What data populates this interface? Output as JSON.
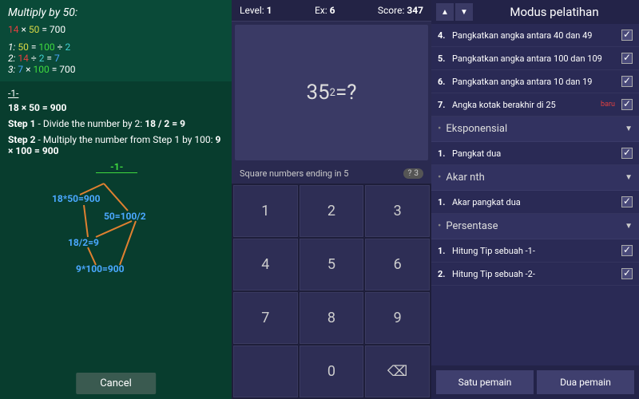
{
  "panel1": {
    "title": "Multiply by 50:",
    "topEq": {
      "a": "14",
      "b": "50",
      "res": "700"
    },
    "hints": [
      {
        "n": "1:",
        "parts": [
          {
            "t": "50",
            "c": "yel"
          },
          {
            "t": " = ",
            "c": "wht"
          },
          {
            "t": "100",
            "c": "grn"
          },
          {
            "t": " ÷ ",
            "c": "wht"
          },
          {
            "t": "2",
            "c": "cyan"
          }
        ]
      },
      {
        "n": "2:",
        "parts": [
          {
            "t": "14",
            "c": "red"
          },
          {
            "t": " ÷ ",
            "c": "wht"
          },
          {
            "t": "2",
            "c": "cyan"
          },
          {
            "t": " = ",
            "c": "wht"
          },
          {
            "t": "7",
            "c": "blu"
          }
        ]
      },
      {
        "n": "3:",
        "parts": [
          {
            "t": "7",
            "c": "blu"
          },
          {
            "t": " × ",
            "c": "wht"
          },
          {
            "t": "100",
            "c": "grn"
          },
          {
            "t": " = 700",
            "c": "wht"
          }
        ]
      }
    ],
    "section": "-1-",
    "eq2": "18 × 50 = 900",
    "step1lbl": "Step 1",
    "step1txt": " - Divide the number by 2: ",
    "step1b": "18 / 2 = 9",
    "step2lbl": "Step 2",
    "step2txt": " - Multiply the number from Step 1 by 100: ",
    "step2b": "9 × 100 = 900",
    "diag": {
      "top": "-1-",
      "n1": "18*50=900",
      "n2": "50=100/2",
      "n3": "18/2=9",
      "n4": "9*100=900"
    },
    "cancel": "Cancel"
  },
  "panel2": {
    "level_lbl": "Level:",
    "level": "1",
    "ex_lbl": "Ex:",
    "ex": "6",
    "score_lbl": "Score:",
    "score": "347",
    "q_base": "35",
    "q_exp": "2",
    "q_suffix": "=?",
    "hint": "Square numbers ending in 5",
    "hint_n": "3",
    "keys": [
      "1",
      "2",
      "3",
      "4",
      "5",
      "6",
      "7",
      "8",
      "9",
      "",
      "0",
      "⌫"
    ]
  },
  "panel3": {
    "title": "Modus pelatihan",
    "items": [
      {
        "type": "item",
        "n": "4.",
        "label": "Pangkatkan angka antara 40 dan 49"
      },
      {
        "type": "item",
        "n": "5.",
        "label": "Pangkatkan angka antara 100 dan 109"
      },
      {
        "type": "item",
        "n": "6.",
        "label": "Pangkatkan angka antara 10 dan 19"
      },
      {
        "type": "item",
        "n": "7.",
        "label": "Angka kotak berakhir di 25",
        "baru": "baru"
      },
      {
        "type": "section",
        "label": "Eksponensial"
      },
      {
        "type": "item",
        "n": "1.",
        "label": "Pangkat dua"
      },
      {
        "type": "section",
        "label": "Akar nth"
      },
      {
        "type": "item",
        "n": "1.",
        "label": "Akar pangkat dua"
      },
      {
        "type": "section",
        "label": "Persentase"
      },
      {
        "type": "item",
        "n": "1.",
        "label": "Hitung Tip sebuah -1-"
      },
      {
        "type": "item",
        "n": "2.",
        "label": "Hitung Tip sebuah -2-"
      }
    ],
    "btn1": "Satu pemain",
    "btn2": "Dua pemain"
  }
}
